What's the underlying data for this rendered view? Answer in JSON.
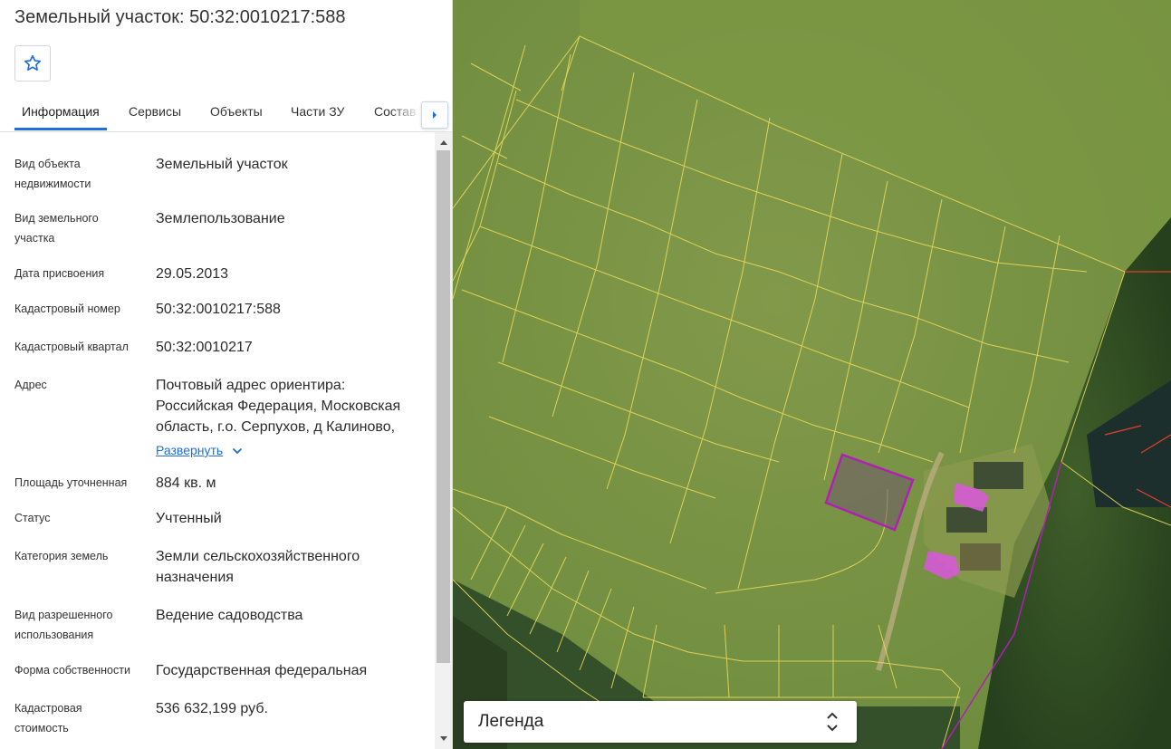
{
  "header": {
    "title": "Земельный участок: 50:32:0010217:588"
  },
  "favorite": {
    "icon": "star-outline-icon"
  },
  "tabs": [
    {
      "label": "Информация",
      "active": true
    },
    {
      "label": "Сервисы",
      "active": false
    },
    {
      "label": "Объекты",
      "active": false
    },
    {
      "label": "Части ЗУ",
      "active": false
    },
    {
      "label": "Состав",
      "active": false
    }
  ],
  "info": [
    {
      "label": "Вид объекта недвижимости",
      "value": "Земельный участок"
    },
    {
      "label": "Вид земельного участка",
      "value": "Землепользование"
    },
    {
      "label": "Дата присвоения",
      "value": "29.05.2013"
    },
    {
      "label": "Кадастровый номер",
      "value": "50:32:0010217:588"
    },
    {
      "label": "Кадастровый квартал",
      "value": "50:32:0010217"
    },
    {
      "label": "Адрес",
      "value": "Почтовый адрес ориентира: Российская Федерация, Московская область, г.о. Серпухов, д Калиново,",
      "expand": "Развернуть"
    },
    {
      "label": "Площадь уточненная",
      "value": "884 кв. м"
    },
    {
      "label": "Статус",
      "value": "Учтенный"
    },
    {
      "label": "Категория земель",
      "value": "Земли сельскохозяйственного назначения"
    },
    {
      "label": "Вид разрешенного использования",
      "value": "Ведение садоводства"
    },
    {
      "label": "Форма собственности",
      "value": "Государственная федеральная"
    },
    {
      "label": "Кадастровая стоимость",
      "value": "536 632,199 руб."
    }
  ],
  "legend": {
    "label": "Легенда"
  },
  "colors": {
    "accent": "#1e6fd9",
    "parcel_lines": "#e8d85a",
    "selected_parcel": "#b21fb5",
    "building": "#d65ad6",
    "boundary_red": "#e0402a"
  }
}
